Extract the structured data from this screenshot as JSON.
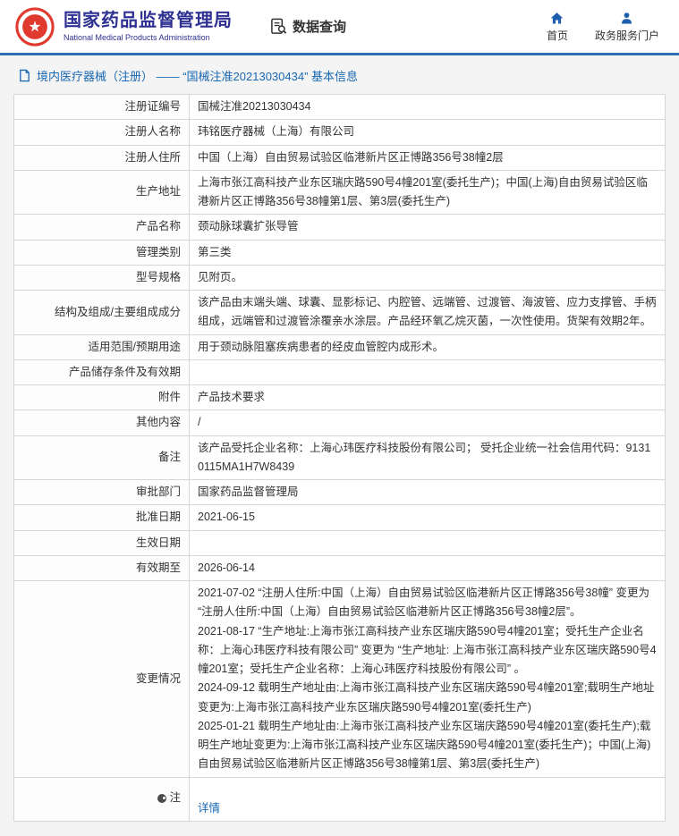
{
  "header": {
    "agency_name_cn": "国家药品监督管理局",
    "agency_name_en": "National Medical Products Administration",
    "data_query_label": "数据查询",
    "nav": {
      "home_label": "首页",
      "portal_label": "政务服务门户"
    }
  },
  "breadcrumb": {
    "text": "境内医疗器械（注册） —— “国械注准20213030434” 基本信息"
  },
  "colors": {
    "brand_blue": "#2e3192",
    "link_blue": "#1767b2",
    "emblem_red": "#e0392e",
    "header_rule_blue": "#2e6cb5"
  },
  "table": {
    "rows": [
      {
        "label": "注册证编号",
        "value": "国械注准20213030434"
      },
      {
        "label": "注册人名称",
        "value": "玮铭医疗器械（上海）有限公司"
      },
      {
        "label": "注册人住所",
        "value": "中国（上海）自由贸易试验区临港新片区正博路356号38幢2层"
      },
      {
        "label": "生产地址",
        "value": "上海市张江高科技产业东区瑞庆路590号4幢201室(委托生产)；中国(上海)自由贸易试验区临港新片区正博路356号38幢第1层、第3层(委托生产)"
      },
      {
        "label": "产品名称",
        "value": "颈动脉球囊扩张导管"
      },
      {
        "label": "管理类别",
        "value": "第三类"
      },
      {
        "label": "型号规格",
        "value": "见附页。"
      },
      {
        "label": "结构及组成/主要组成成分",
        "value": "该产品由末端头端、球囊、显影标记、内腔管、远端管、过渡管、海波管、应力支撑管、手柄组成，远端管和过渡管涂覆亲水涂层。产品经环氧乙烷灭菌，一次性使用。货架有效期2年。"
      },
      {
        "label": "适用范围/预期用途",
        "value": "用于颈动脉阻塞疾病患者的经皮血管腔内成形术。"
      },
      {
        "label": "产品储存条件及有效期",
        "value": ""
      },
      {
        "label": "附件",
        "value": "产品技术要求"
      },
      {
        "label": "其他内容",
        "value": "/"
      },
      {
        "label": "备注",
        "value": "该产品受托企业名称：上海心玮医疗科技股份有限公司； 受托企业统一社会信用代码：91310115MA1H7W8439"
      },
      {
        "label": "审批部门",
        "value": "国家药品监督管理局"
      },
      {
        "label": "批准日期",
        "value": "2021-06-15"
      },
      {
        "label": "生效日期",
        "value": ""
      },
      {
        "label": "有效期至",
        "value": "2026-06-14"
      },
      {
        "label": "变更情况",
        "value": "2021-07-02 “注册人住所:中国（上海）自由贸易试验区临港新片区正博路356号38幢” 变更为 “注册人住所:中国（上海）自由贸易试验区临港新片区正博路356号38幢2层”。\n2021-08-17 “生产地址:上海市张江高科技产业东区瑞庆路590号4幢201室；受托生产企业名称：上海心玮医疗科技有限公司” 变更为 “生产地址: 上海市张江高科技产业东区瑞庆路590号4幢201室；受托生产企业名称：上海心玮医疗科技股份有限公司” 。\n2024-09-12 载明生产地址由:上海市张江高科技产业东区瑞庆路590号4幢201室;载明生产地址变更为:上海市张江高科技产业东区瑞庆路590号4幢201室(委托生产)\n2025-01-21 载明生产地址由:上海市张江高科技产业东区瑞庆路590号4幢201室(委托生产);载明生产地址变更为:上海市张江高科技产业东区瑞庆路590号4幢201室(委托生产)；中国(上海)自由贸易试验区临港新片区正博路356号38幢第1层、第3层(委托生产)"
      },
      {
        "label": "注",
        "value": "详情"
      }
    ]
  }
}
